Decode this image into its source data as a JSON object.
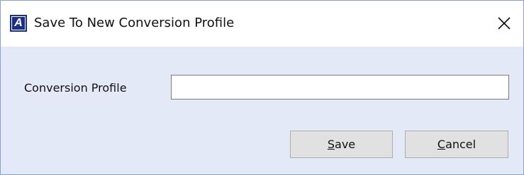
{
  "dialog": {
    "title": "Save To New Conversion Profile",
    "app_icon_letter": "A",
    "close_glyph": "close-icon"
  },
  "form": {
    "label": "Conversion Profile",
    "input_value": "",
    "input_placeholder": ""
  },
  "buttons": {
    "save": {
      "mnemonic": "S",
      "rest": "ave"
    },
    "cancel": {
      "mnemonic": "C",
      "rest": "ancel"
    }
  },
  "colors": {
    "dialog_background": "#e4e9f7",
    "titlebar_background": "#ffffff",
    "window_border": "#8a9fd3",
    "app_icon_blue": "#1c2f88",
    "button_face": "#e1e1e1"
  }
}
